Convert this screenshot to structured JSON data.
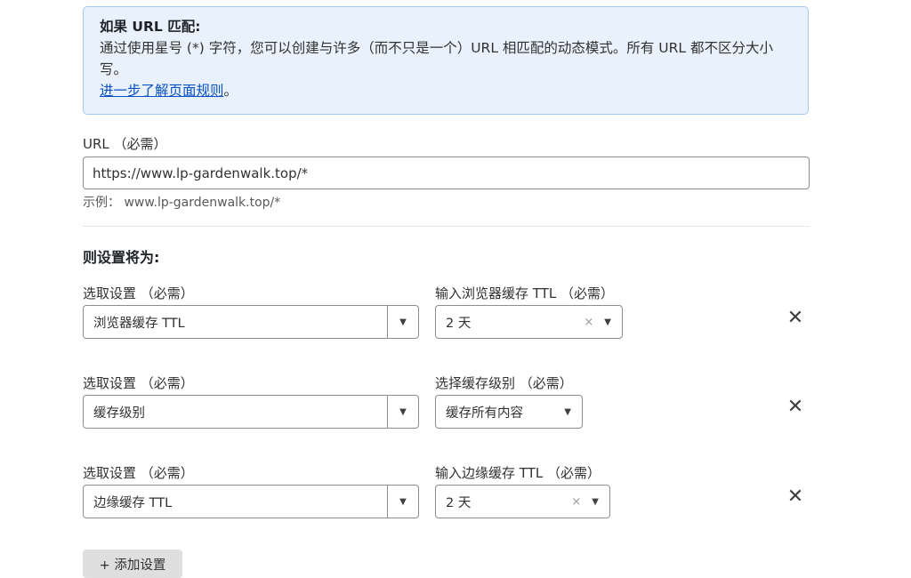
{
  "info": {
    "title": "如果 URL 匹配:",
    "body": "通过使用星号 (*) 字符，您可以创建与许多（而不只是一个）URL 相匹配的动态模式。所有 URL 都不区分大小写。",
    "link": "进一步了解页面规则",
    "link_suffix": "。"
  },
  "url": {
    "label": "URL （必需）",
    "value": "https://www.lp-gardenwalk.top/*",
    "hint": "示例：  www.lp-gardenwalk.top/*"
  },
  "settings_title": "则设置将为:",
  "rows": [
    {
      "setting_label": "选取设置 （必需）",
      "setting_value": "浏览器缓存 TTL",
      "value_label": "输入浏览器缓存 TTL （必需）",
      "value": "2 天",
      "clear": "×",
      "caret": "▼",
      "remove": "✕"
    },
    {
      "setting_label": "选取设置 （必需）",
      "setting_value": "缓存级别",
      "value_label": "选择缓存级别 （必需）",
      "value": "缓存所有内容",
      "caret": "▼",
      "remove": "✕"
    },
    {
      "setting_label": "选取设置 （必需）",
      "setting_value": "边缘缓存 TTL",
      "value_label": "输入边缘缓存 TTL （必需）",
      "value": "2 天",
      "clear": "×",
      "caret": "▼",
      "remove": "✕"
    }
  ],
  "add_button": "+ 添加设置",
  "dropdown_caret": "▼"
}
